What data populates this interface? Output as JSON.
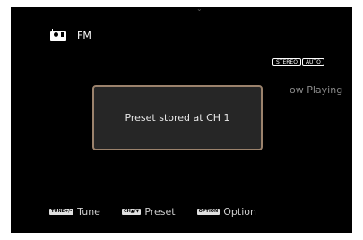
{
  "source": {
    "icon": "radio-icon",
    "label": "FM"
  },
  "indicators": {
    "stereo": "STEREO",
    "auto": "AUTO"
  },
  "now_playing": "ow Playing",
  "popup": {
    "message": "Preset stored at CH 1"
  },
  "footer": {
    "tune": {
      "key": "TUNE+/-",
      "label": "Tune"
    },
    "preset": {
      "key": "CH▲/▼",
      "label": "Preset"
    },
    "option": {
      "key": "OPTION",
      "label": "Option"
    }
  },
  "colors": {
    "background": "#000000",
    "popup_border": "#9b826c",
    "popup_fill": "#262626"
  }
}
